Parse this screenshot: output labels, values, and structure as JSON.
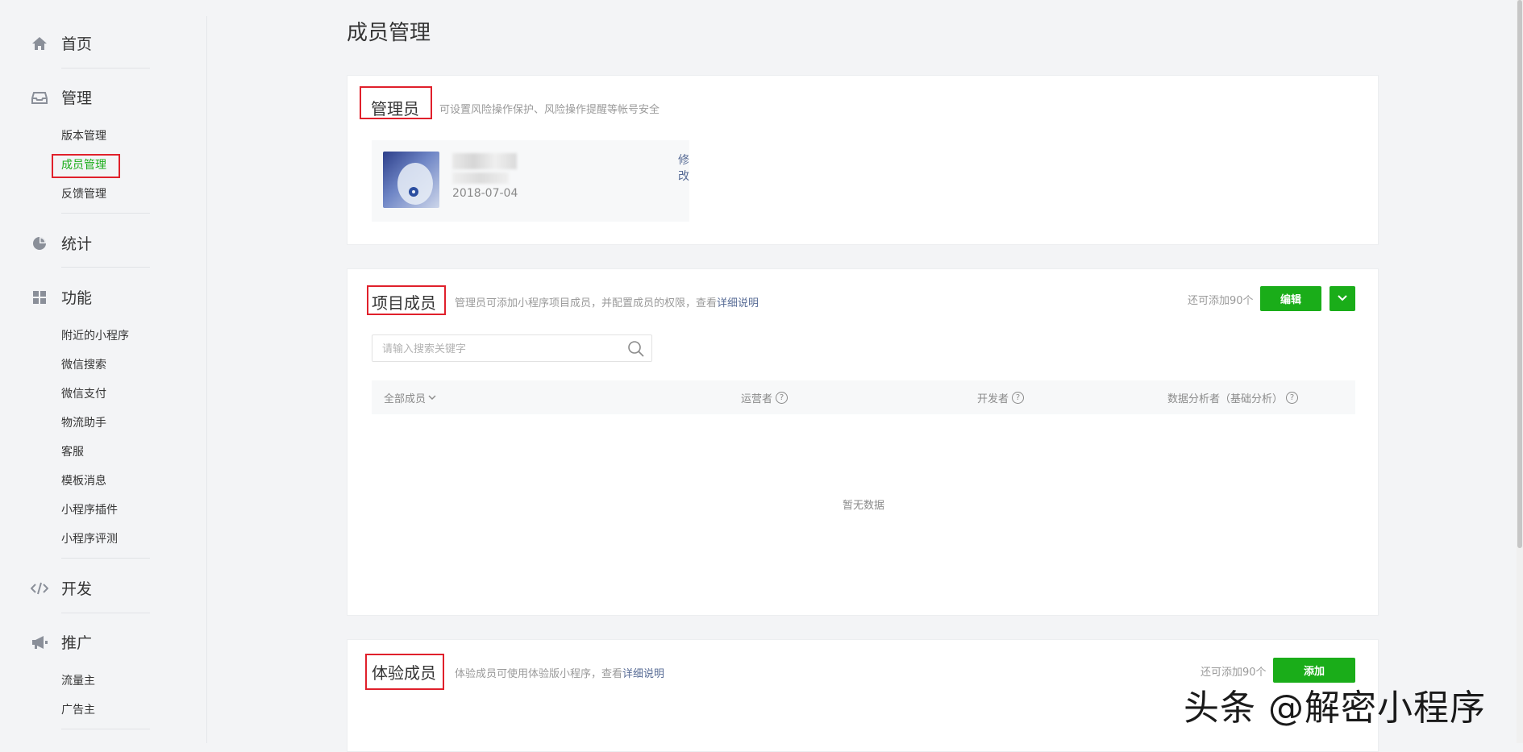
{
  "sidebar": {
    "home": {
      "label": "首页",
      "icon": "home-icon"
    },
    "manage": {
      "label": "管理",
      "icon": "inbox-icon",
      "items": [
        "版本管理",
        "成员管理",
        "反馈管理"
      ],
      "active": "成员管理"
    },
    "stats": {
      "label": "统计",
      "icon": "pie-chart-icon"
    },
    "features": {
      "label": "功能",
      "icon": "grid-icon",
      "items": [
        "附近的小程序",
        "微信搜索",
        "微信支付",
        "物流助手",
        "客服",
        "模板消息",
        "小程序插件",
        "小程序评测"
      ]
    },
    "dev": {
      "label": "开发",
      "icon": "code-icon"
    },
    "promo": {
      "label": "推广",
      "icon": "megaphone-icon",
      "items": [
        "流量主",
        "广告主"
      ]
    }
  },
  "page": {
    "title": "成员管理"
  },
  "admin": {
    "title": "管理员",
    "desc": "可设置风险操作保护、风险操作提醒等帐号安全",
    "date": "2018-07-04",
    "edit_label": "修改"
  },
  "project": {
    "title": "项目成员",
    "desc": "管理员可添加小程序项目成员，并配置成员的权限，查看",
    "desc_link": "详细说明",
    "quota": "还可添加90个",
    "edit_button": "编辑",
    "search_placeholder": "请输入搜索关键字",
    "columns": {
      "all": "全部成员",
      "operator": "运营者",
      "developer": "开发者",
      "analyst": "数据分析者（基础分析）"
    },
    "empty": "暂无数据"
  },
  "trial": {
    "title": "体验成员",
    "desc": "体验成员可使用体验版小程序，查看",
    "desc_link": "详细说明",
    "quota": "还可添加90个",
    "add_button": "添加"
  },
  "watermark": "头条 @解密小程序",
  "colors": {
    "accent": "#1aad19",
    "link": "#576b95",
    "highlight_box": "#e0202b"
  }
}
